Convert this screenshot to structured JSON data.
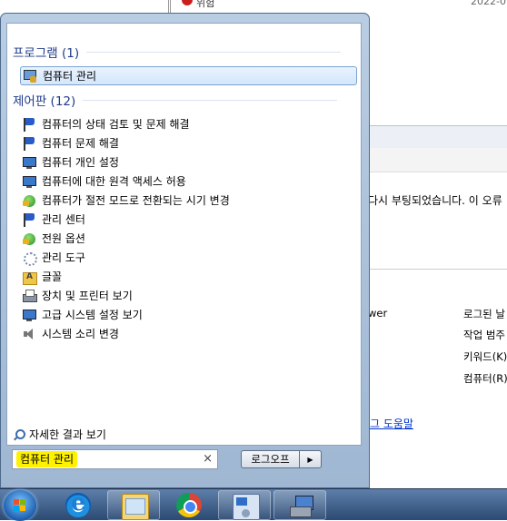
{
  "background": {
    "top_row_level": "위험",
    "top_row_date": "2022-0",
    "message": "다시 부팅되었습니다. 이 오류",
    "props_labels": [
      "wer",
      "로그된 날",
      "작업 범주",
      "키워드(K)",
      "컴퓨터(R)"
    ],
    "help_link": "그 도움말"
  },
  "start_menu": {
    "groups": [
      {
        "header": "프로그램 (1)",
        "items": [
          {
            "label": "컴퓨터 관리",
            "icon": "computer-management-icon"
          }
        ]
      },
      {
        "header": "제어판 (12)",
        "items": [
          {
            "label": "컴퓨터의 상태 검토 및 문제 해결",
            "icon": "action-center-flag-icon"
          },
          {
            "label": "컴퓨터 문제 해결",
            "icon": "action-center-flag-icon"
          },
          {
            "label": "컴퓨터 개인 설정",
            "icon": "personalization-monitor-icon"
          },
          {
            "label": "컴퓨터에 대한 원격 액세스 허용",
            "icon": "system-monitor-icon"
          },
          {
            "label": "컴퓨터가 절전 모드로 전환되는 시기 변경",
            "icon": "power-options-icon"
          },
          {
            "label": "관리 센터",
            "icon": "action-center-flag-icon"
          },
          {
            "label": "전원 옵션",
            "icon": "power-options-icon"
          },
          {
            "label": "관리 도구",
            "icon": "admin-tools-gear-icon"
          },
          {
            "label": "글꼴",
            "icon": "fonts-folder-icon"
          },
          {
            "label": "장치 및 프린터 보기",
            "icon": "printer-icon"
          },
          {
            "label": "고급 시스템 설정 보기",
            "icon": "system-monitor-icon"
          },
          {
            "label": "시스템 소리 변경",
            "icon": "speaker-icon"
          }
        ]
      }
    ],
    "more_results": "자세한 결과 보기",
    "search": {
      "value": "컴퓨터 관리",
      "clear_glyph": "×"
    },
    "logoff_label": "로그오프",
    "logoff_arrow": "▶"
  },
  "taskbar": {
    "pinned": [
      "internet-explorer-icon",
      "windows-explorer-icon",
      "chrome-icon",
      "control-panel-icon",
      "computer-management-icon"
    ]
  }
}
